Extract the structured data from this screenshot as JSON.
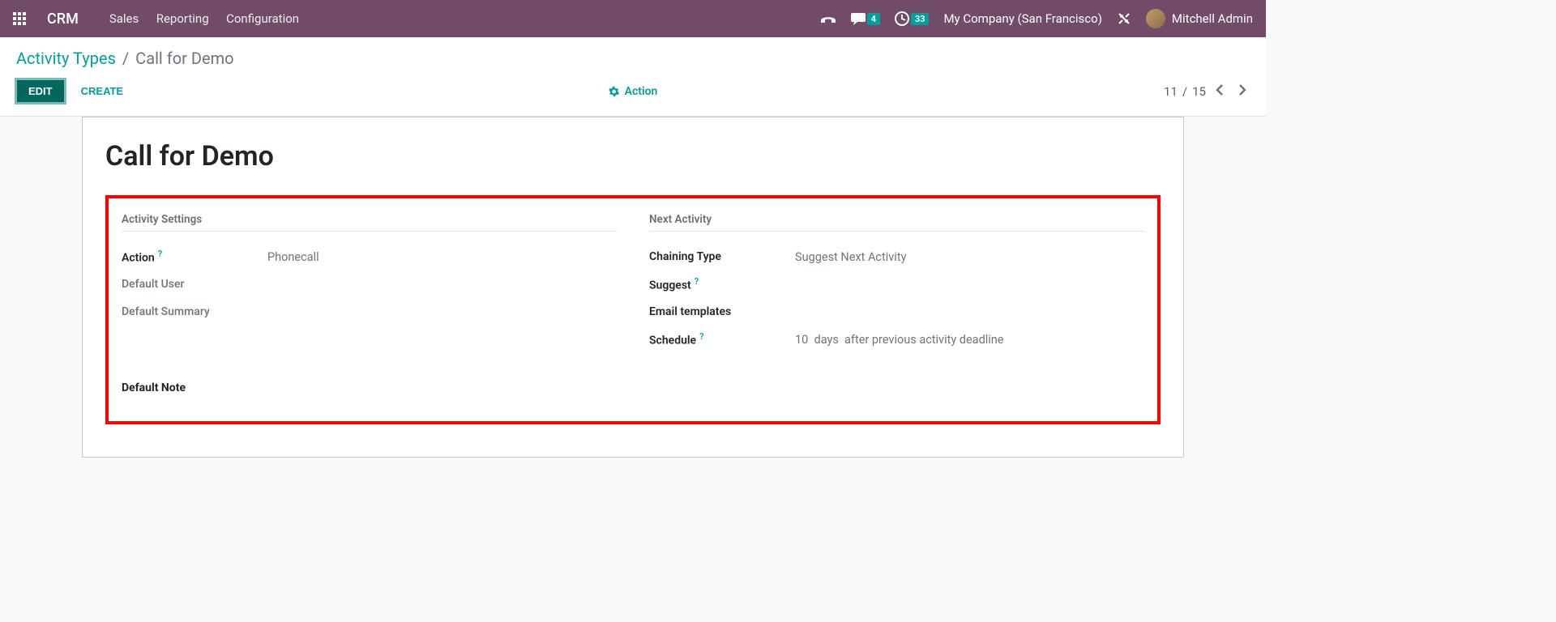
{
  "topbar": {
    "app": "CRM",
    "menu": [
      "Sales",
      "Reporting",
      "Configuration"
    ],
    "msg_count": "4",
    "activity_count": "33",
    "company": "My Company (San Francisco)",
    "user": "Mitchell Admin"
  },
  "breadcrumb": {
    "parent": "Activity Types",
    "current": "Call for Demo"
  },
  "buttons": {
    "edit": "EDIT",
    "create": "CREATE",
    "action": "Action"
  },
  "pager": {
    "current": "11",
    "total": "15",
    "sep": "/"
  },
  "form": {
    "title": "Call for Demo",
    "section_left": "Activity Settings",
    "section_right": "Next Activity",
    "labels": {
      "action": "Action",
      "default_user": "Default User",
      "default_summary": "Default Summary",
      "chaining_type": "Chaining Type",
      "suggest": "Suggest",
      "email_templates": "Email templates",
      "schedule": "Schedule",
      "default_note": "Default Note"
    },
    "values": {
      "action": "Phonecall",
      "chaining_type": "Suggest Next Activity",
      "schedule_num": "10",
      "schedule_unit": "days",
      "schedule_text": "after previous activity deadline"
    },
    "help": "?"
  }
}
